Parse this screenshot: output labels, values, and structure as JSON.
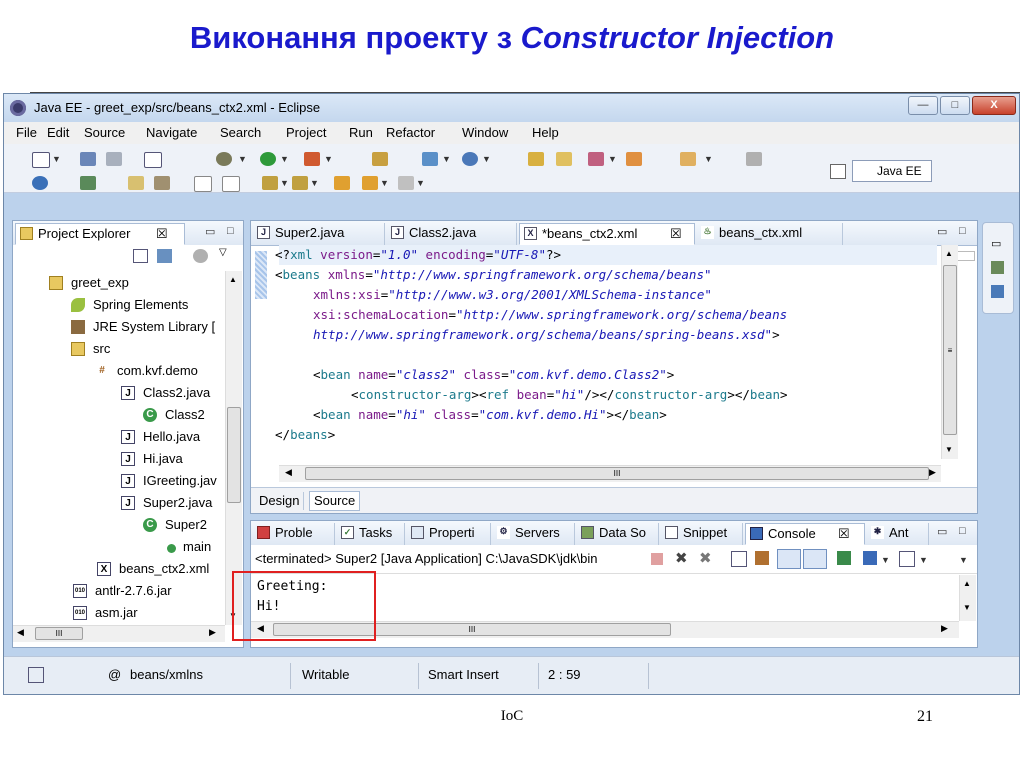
{
  "slide": {
    "title_plain": "Виконання  проекту з ",
    "title_italic": "Constructor Injection",
    "footer_center": "IoC",
    "page_number": "21"
  },
  "window": {
    "title": "Java EE - greet_exp/src/beans_ctx2.xml - Eclipse",
    "controls": {
      "minimize": "—",
      "maximize": "□",
      "close": "X"
    }
  },
  "menu": [
    "File",
    "Edit",
    "Source",
    "Navigate",
    "Search",
    "Project",
    "Run",
    "Refactor",
    "Window",
    "Help"
  ],
  "toolbar": {
    "perspective_label": "Java EE"
  },
  "explorer": {
    "tab_label": "Project Explorer",
    "tab_close": "☒",
    "items": [
      {
        "label": "greet_exp",
        "icon": "project-icon"
      },
      {
        "label": "Spring Elements",
        "icon": "spring-leaf-icon"
      },
      {
        "label": "JRE System Library [",
        "icon": "library-icon"
      },
      {
        "label": "src",
        "icon": "source-folder-icon"
      },
      {
        "label": "com.kvf.demo",
        "icon": "package-icon"
      },
      {
        "label": "Class2.java",
        "icon": "java-file-icon"
      },
      {
        "label": "Class2",
        "icon": "class-icon"
      },
      {
        "label": "Hello.java",
        "icon": "java-file-icon"
      },
      {
        "label": "Hi.java",
        "icon": "java-file-icon"
      },
      {
        "label": "IGreeting.jav",
        "icon": "java-file-icon"
      },
      {
        "label": "Super2.java",
        "icon": "java-file-icon"
      },
      {
        "label": "Super2",
        "icon": "runnable-class-icon"
      },
      {
        "label": "main",
        "icon": "static-method-icon"
      },
      {
        "label": "beans_ctx2.xml",
        "icon": "xml-file-icon"
      },
      {
        "label": "antlr-2.7.6.jar",
        "icon": "jar-icon"
      },
      {
        "label": "asm.jar",
        "icon": "jar-icon"
      }
    ],
    "hscroll_label": "III"
  },
  "editor": {
    "tabs": [
      {
        "label": "Super2.java",
        "icon": "java-file-icon"
      },
      {
        "label": "Class2.java",
        "icon": "java-file-icon"
      },
      {
        "label": "*beans_ctx2.xml",
        "icon": "xml-file-icon",
        "close": "☒"
      },
      {
        "label": "beans_ctx.xml",
        "icon": "spring-beans-icon"
      }
    ],
    "lines": [
      {
        "indent": 0,
        "parts": [
          [
            "pun",
            "<?"
          ],
          [
            "tag",
            "xml"
          ],
          [
            "attr",
            " version"
          ],
          [
            "pun",
            "="
          ],
          [
            "val",
            "\"1.0\""
          ],
          [
            "attr",
            " encoding"
          ],
          [
            "pun",
            "="
          ],
          [
            "val",
            "\"UTF-8\""
          ],
          [
            "pun",
            "?>"
          ]
        ]
      },
      {
        "indent": 0,
        "parts": [
          [
            "pun",
            "<"
          ],
          [
            "tag",
            "beans"
          ],
          [
            "attr",
            " xmlns"
          ],
          [
            "pun",
            "="
          ],
          [
            "val",
            "\"http://www.springframework.org/schema/beans\""
          ]
        ]
      },
      {
        "indent": 1,
        "parts": [
          [
            "attr",
            "xmlns:xsi"
          ],
          [
            "pun",
            "="
          ],
          [
            "val",
            "\"http://www.w3.org/2001/XMLSchema-instance\""
          ]
        ]
      },
      {
        "indent": 1,
        "parts": [
          [
            "attr",
            "xsi:schemaLocation"
          ],
          [
            "pun",
            "="
          ],
          [
            "val",
            "\"http://www.springframework.org/schema/beans"
          ]
        ]
      },
      {
        "indent": 1,
        "parts": [
          [
            "val",
            "http://www.springframework.org/schema/beans/spring-beans.xsd\""
          ],
          [
            "pun",
            ">"
          ]
        ]
      },
      {
        "indent": 0,
        "parts": []
      },
      {
        "indent": 1,
        "parts": [
          [
            "pun",
            "<"
          ],
          [
            "tag",
            "bean"
          ],
          [
            "attr",
            " name"
          ],
          [
            "pun",
            "="
          ],
          [
            "val",
            "\"class2\""
          ],
          [
            "attr",
            " class"
          ],
          [
            "pun",
            "="
          ],
          [
            "val",
            "\"com.kvf.demo.Class2\""
          ],
          [
            "pun",
            ">"
          ]
        ]
      },
      {
        "indent": 2,
        "parts": [
          [
            "pun",
            "<"
          ],
          [
            "tag",
            "constructor-arg"
          ],
          [
            "pun",
            "><"
          ],
          [
            "tag",
            "ref"
          ],
          [
            "attr",
            " bean"
          ],
          [
            "pun",
            "="
          ],
          [
            "val",
            "\"hi\""
          ],
          [
            "pun",
            "/></"
          ],
          [
            "tag",
            "constructor-arg"
          ],
          [
            "pun",
            "></"
          ],
          [
            "tag",
            "bean"
          ],
          [
            "pun",
            ">"
          ]
        ]
      },
      {
        "indent": 1,
        "parts": [
          [
            "pun",
            "<"
          ],
          [
            "tag",
            "bean"
          ],
          [
            "attr",
            " name"
          ],
          [
            "pun",
            "="
          ],
          [
            "val",
            "\"hi\""
          ],
          [
            "attr",
            " class"
          ],
          [
            "pun",
            "="
          ],
          [
            "val",
            "\"com.kvf.demo.Hi\""
          ],
          [
            "pun",
            "></"
          ],
          [
            "tag",
            "bean"
          ],
          [
            "pun",
            ">"
          ]
        ]
      },
      {
        "indent": 0,
        "parts": [
          [
            "pun",
            "</"
          ],
          [
            "tag",
            "beans"
          ],
          [
            "pun",
            ">"
          ]
        ]
      }
    ],
    "hscroll_label": "III",
    "bottom_tabs": [
      "Design",
      "Source"
    ]
  },
  "bottom_panel": {
    "tabs": [
      "Proble",
      "Tasks",
      "Properti",
      "Servers",
      "Data So",
      "Snippet",
      "Console",
      "Ant"
    ],
    "console_close": "☒",
    "terminated_label": "<terminated> Super2 [Java Application] C:\\JavaSDK\\jdk\\bin",
    "output": [
      "Greeting:",
      "Hi!"
    ],
    "hscroll_label": "III"
  },
  "status": {
    "path": "beans/xmlns",
    "path_icon": "@",
    "write_mode": "Writable",
    "insert_mode": "Smart Insert",
    "position": "2 : 59"
  }
}
